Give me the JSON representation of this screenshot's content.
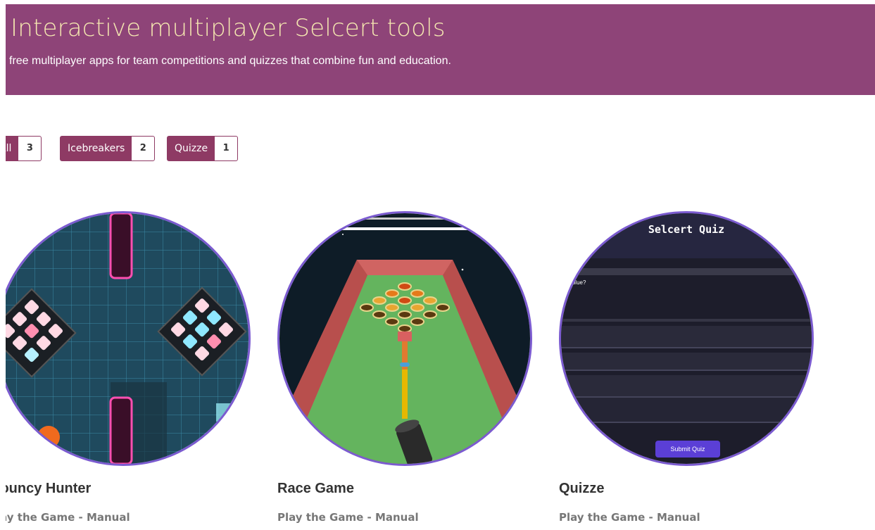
{
  "hero": {
    "title": "Interactive multiplayer Selcert tools",
    "subtitle": "free multiplayer apps for team competitions and quizzes that combine fun and education."
  },
  "filters": [
    {
      "label": "All",
      "count": "3"
    },
    {
      "label": "Icebreakers",
      "count": "2"
    },
    {
      "label": "Quizze",
      "count": "1"
    }
  ],
  "cards": [
    {
      "title": "Bouncy Hunter",
      "link": "Play the Game - Manual"
    },
    {
      "title": "Race Game",
      "link": "Play the Game - Manual"
    },
    {
      "title": "Quizze",
      "link": "Play the Game - Manual"
    }
  ],
  "quiz_preview": {
    "header": "Selcert Quiz",
    "question": "What do you get by mixing red and blue?",
    "submit": "Submit Quiz"
  },
  "colors": {
    "hero_bg": "#8e4478",
    "filter_bg": "#8e3a64",
    "circle_border": "#7b5bd0"
  }
}
